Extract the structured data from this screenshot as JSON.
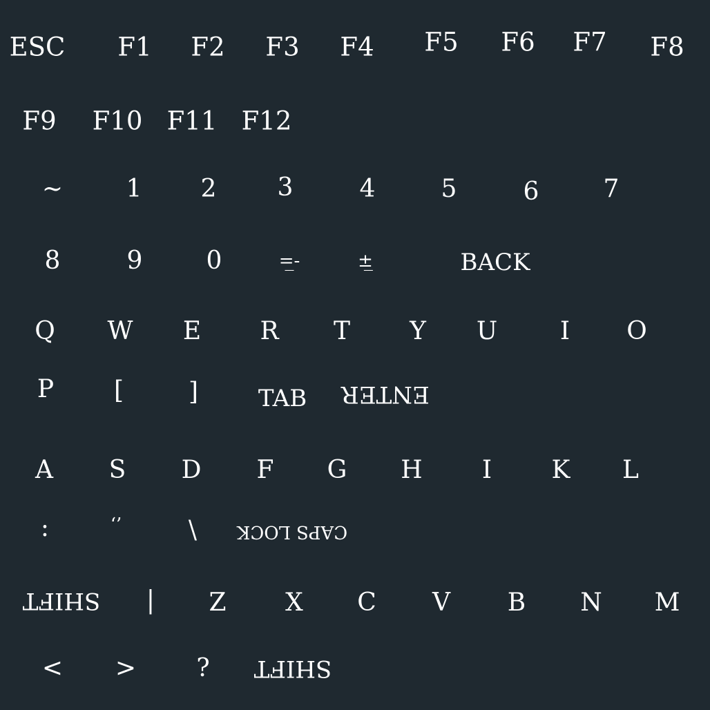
{
  "keys": {
    "esc": "ESC",
    "f1": "F1",
    "f2": "F2",
    "f3": "F3",
    "f4": "F4",
    "f5": "F5",
    "f6": "F6",
    "f7": "F7",
    "f8": "F8",
    "f9": "F9",
    "f10": "F10",
    "f11": "F11",
    "f12": "F12",
    "tilde": "~",
    "n1": "1",
    "n2": "2",
    "n3": "3",
    "n4": "4",
    "n5": "5",
    "n6": "6",
    "n7": "7",
    "n8": "8",
    "n9": "9",
    "n0": "0",
    "minus": "=̲-",
    "plus": "±̲",
    "back": "BACK",
    "q": "Q",
    "w": "W",
    "e": "E",
    "r": "R",
    "t": "T",
    "y": "Y",
    "u": "U",
    "i": "I",
    "o": "O",
    "p": "P",
    "lbracket": "[",
    "rbracket": "]",
    "tab": "TAB",
    "enter": "ENTER",
    "a": "A",
    "s": "S",
    "d": "D",
    "f": "F",
    "g": "G",
    "h": "H",
    "j": "I",
    "k": "K",
    "l": "L",
    "colon": ":",
    "quote": "‘’",
    "backslash": "\\",
    "capslock": "CAPS LOCK",
    "shift_left": "SHIFT",
    "pipe": "|",
    "z": "Z",
    "x": "X",
    "c": "C",
    "v": "V",
    "b": "B",
    "n": "N",
    "m": "M",
    "less": "<",
    "greater": ">",
    "question": "?",
    "shift_right": "SHIFT"
  }
}
